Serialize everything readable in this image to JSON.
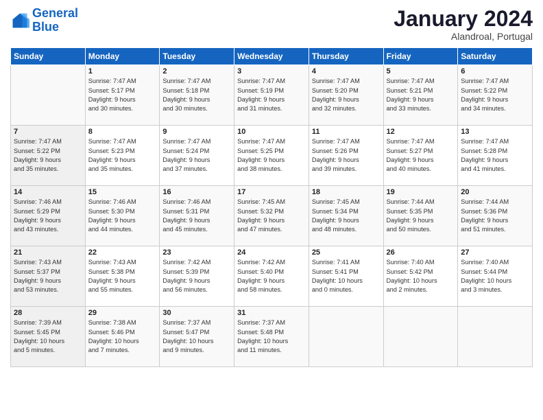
{
  "header": {
    "logo_line1": "General",
    "logo_line2": "Blue",
    "month": "January 2024",
    "location": "Alandroal, Portugal"
  },
  "weekdays": [
    "Sunday",
    "Monday",
    "Tuesday",
    "Wednesday",
    "Thursday",
    "Friday",
    "Saturday"
  ],
  "weeks": [
    [
      {
        "day": "",
        "sunrise": "",
        "sunset": "",
        "daylight": ""
      },
      {
        "day": "1",
        "sunrise": "Sunrise: 7:47 AM",
        "sunset": "Sunset: 5:17 PM",
        "daylight": "Daylight: 9 hours and 30 minutes."
      },
      {
        "day": "2",
        "sunrise": "Sunrise: 7:47 AM",
        "sunset": "Sunset: 5:18 PM",
        "daylight": "Daylight: 9 hours and 30 minutes."
      },
      {
        "day": "3",
        "sunrise": "Sunrise: 7:47 AM",
        "sunset": "Sunset: 5:19 PM",
        "daylight": "Daylight: 9 hours and 31 minutes."
      },
      {
        "day": "4",
        "sunrise": "Sunrise: 7:47 AM",
        "sunset": "Sunset: 5:20 PM",
        "daylight": "Daylight: 9 hours and 32 minutes."
      },
      {
        "day": "5",
        "sunrise": "Sunrise: 7:47 AM",
        "sunset": "Sunset: 5:21 PM",
        "daylight": "Daylight: 9 hours and 33 minutes."
      },
      {
        "day": "6",
        "sunrise": "Sunrise: 7:47 AM",
        "sunset": "Sunset: 5:22 PM",
        "daylight": "Daylight: 9 hours and 34 minutes."
      }
    ],
    [
      {
        "day": "7",
        "sunrise": "Sunrise: 7:47 AM",
        "sunset": "Sunset: 5:22 PM",
        "daylight": "Daylight: 9 hours and 35 minutes."
      },
      {
        "day": "8",
        "sunrise": "Sunrise: 7:47 AM",
        "sunset": "Sunset: 5:23 PM",
        "daylight": "Daylight: 9 hours and 35 minutes."
      },
      {
        "day": "9",
        "sunrise": "Sunrise: 7:47 AM",
        "sunset": "Sunset: 5:24 PM",
        "daylight": "Daylight: 9 hours and 37 minutes."
      },
      {
        "day": "10",
        "sunrise": "Sunrise: 7:47 AM",
        "sunset": "Sunset: 5:25 PM",
        "daylight": "Daylight: 9 hours and 38 minutes."
      },
      {
        "day": "11",
        "sunrise": "Sunrise: 7:47 AM",
        "sunset": "Sunset: 5:26 PM",
        "daylight": "Daylight: 9 hours and 39 minutes."
      },
      {
        "day": "12",
        "sunrise": "Sunrise: 7:47 AM",
        "sunset": "Sunset: 5:27 PM",
        "daylight": "Daylight: 9 hours and 40 minutes."
      },
      {
        "day": "13",
        "sunrise": "Sunrise: 7:47 AM",
        "sunset": "Sunset: 5:28 PM",
        "daylight": "Daylight: 9 hours and 41 minutes."
      }
    ],
    [
      {
        "day": "14",
        "sunrise": "Sunrise: 7:46 AM",
        "sunset": "Sunset: 5:29 PM",
        "daylight": "Daylight: 9 hours and 43 minutes."
      },
      {
        "day": "15",
        "sunrise": "Sunrise: 7:46 AM",
        "sunset": "Sunset: 5:30 PM",
        "daylight": "Daylight: 9 hours and 44 minutes."
      },
      {
        "day": "16",
        "sunrise": "Sunrise: 7:46 AM",
        "sunset": "Sunset: 5:31 PM",
        "daylight": "Daylight: 9 hours and 45 minutes."
      },
      {
        "day": "17",
        "sunrise": "Sunrise: 7:45 AM",
        "sunset": "Sunset: 5:32 PM",
        "daylight": "Daylight: 9 hours and 47 minutes."
      },
      {
        "day": "18",
        "sunrise": "Sunrise: 7:45 AM",
        "sunset": "Sunset: 5:34 PM",
        "daylight": "Daylight: 9 hours and 48 minutes."
      },
      {
        "day": "19",
        "sunrise": "Sunrise: 7:44 AM",
        "sunset": "Sunset: 5:35 PM",
        "daylight": "Daylight: 9 hours and 50 minutes."
      },
      {
        "day": "20",
        "sunrise": "Sunrise: 7:44 AM",
        "sunset": "Sunset: 5:36 PM",
        "daylight": "Daylight: 9 hours and 51 minutes."
      }
    ],
    [
      {
        "day": "21",
        "sunrise": "Sunrise: 7:43 AM",
        "sunset": "Sunset: 5:37 PM",
        "daylight": "Daylight: 9 hours and 53 minutes."
      },
      {
        "day": "22",
        "sunrise": "Sunrise: 7:43 AM",
        "sunset": "Sunset: 5:38 PM",
        "daylight": "Daylight: 9 hours and 55 minutes."
      },
      {
        "day": "23",
        "sunrise": "Sunrise: 7:42 AM",
        "sunset": "Sunset: 5:39 PM",
        "daylight": "Daylight: 9 hours and 56 minutes."
      },
      {
        "day": "24",
        "sunrise": "Sunrise: 7:42 AM",
        "sunset": "Sunset: 5:40 PM",
        "daylight": "Daylight: 9 hours and 58 minutes."
      },
      {
        "day": "25",
        "sunrise": "Sunrise: 7:41 AM",
        "sunset": "Sunset: 5:41 PM",
        "daylight": "Daylight: 10 hours and 0 minutes."
      },
      {
        "day": "26",
        "sunrise": "Sunrise: 7:40 AM",
        "sunset": "Sunset: 5:42 PM",
        "daylight": "Daylight: 10 hours and 2 minutes."
      },
      {
        "day": "27",
        "sunrise": "Sunrise: 7:40 AM",
        "sunset": "Sunset: 5:44 PM",
        "daylight": "Daylight: 10 hours and 3 minutes."
      }
    ],
    [
      {
        "day": "28",
        "sunrise": "Sunrise: 7:39 AM",
        "sunset": "Sunset: 5:45 PM",
        "daylight": "Daylight: 10 hours and 5 minutes."
      },
      {
        "day": "29",
        "sunrise": "Sunrise: 7:38 AM",
        "sunset": "Sunset: 5:46 PM",
        "daylight": "Daylight: 10 hours and 7 minutes."
      },
      {
        "day": "30",
        "sunrise": "Sunrise: 7:37 AM",
        "sunset": "Sunset: 5:47 PM",
        "daylight": "Daylight: 10 hours and 9 minutes."
      },
      {
        "day": "31",
        "sunrise": "Sunrise: 7:37 AM",
        "sunset": "Sunset: 5:48 PM",
        "daylight": "Daylight: 10 hours and 11 minutes."
      },
      {
        "day": "",
        "sunrise": "",
        "sunset": "",
        "daylight": ""
      },
      {
        "day": "",
        "sunrise": "",
        "sunset": "",
        "daylight": ""
      },
      {
        "day": "",
        "sunrise": "",
        "sunset": "",
        "daylight": ""
      }
    ]
  ]
}
